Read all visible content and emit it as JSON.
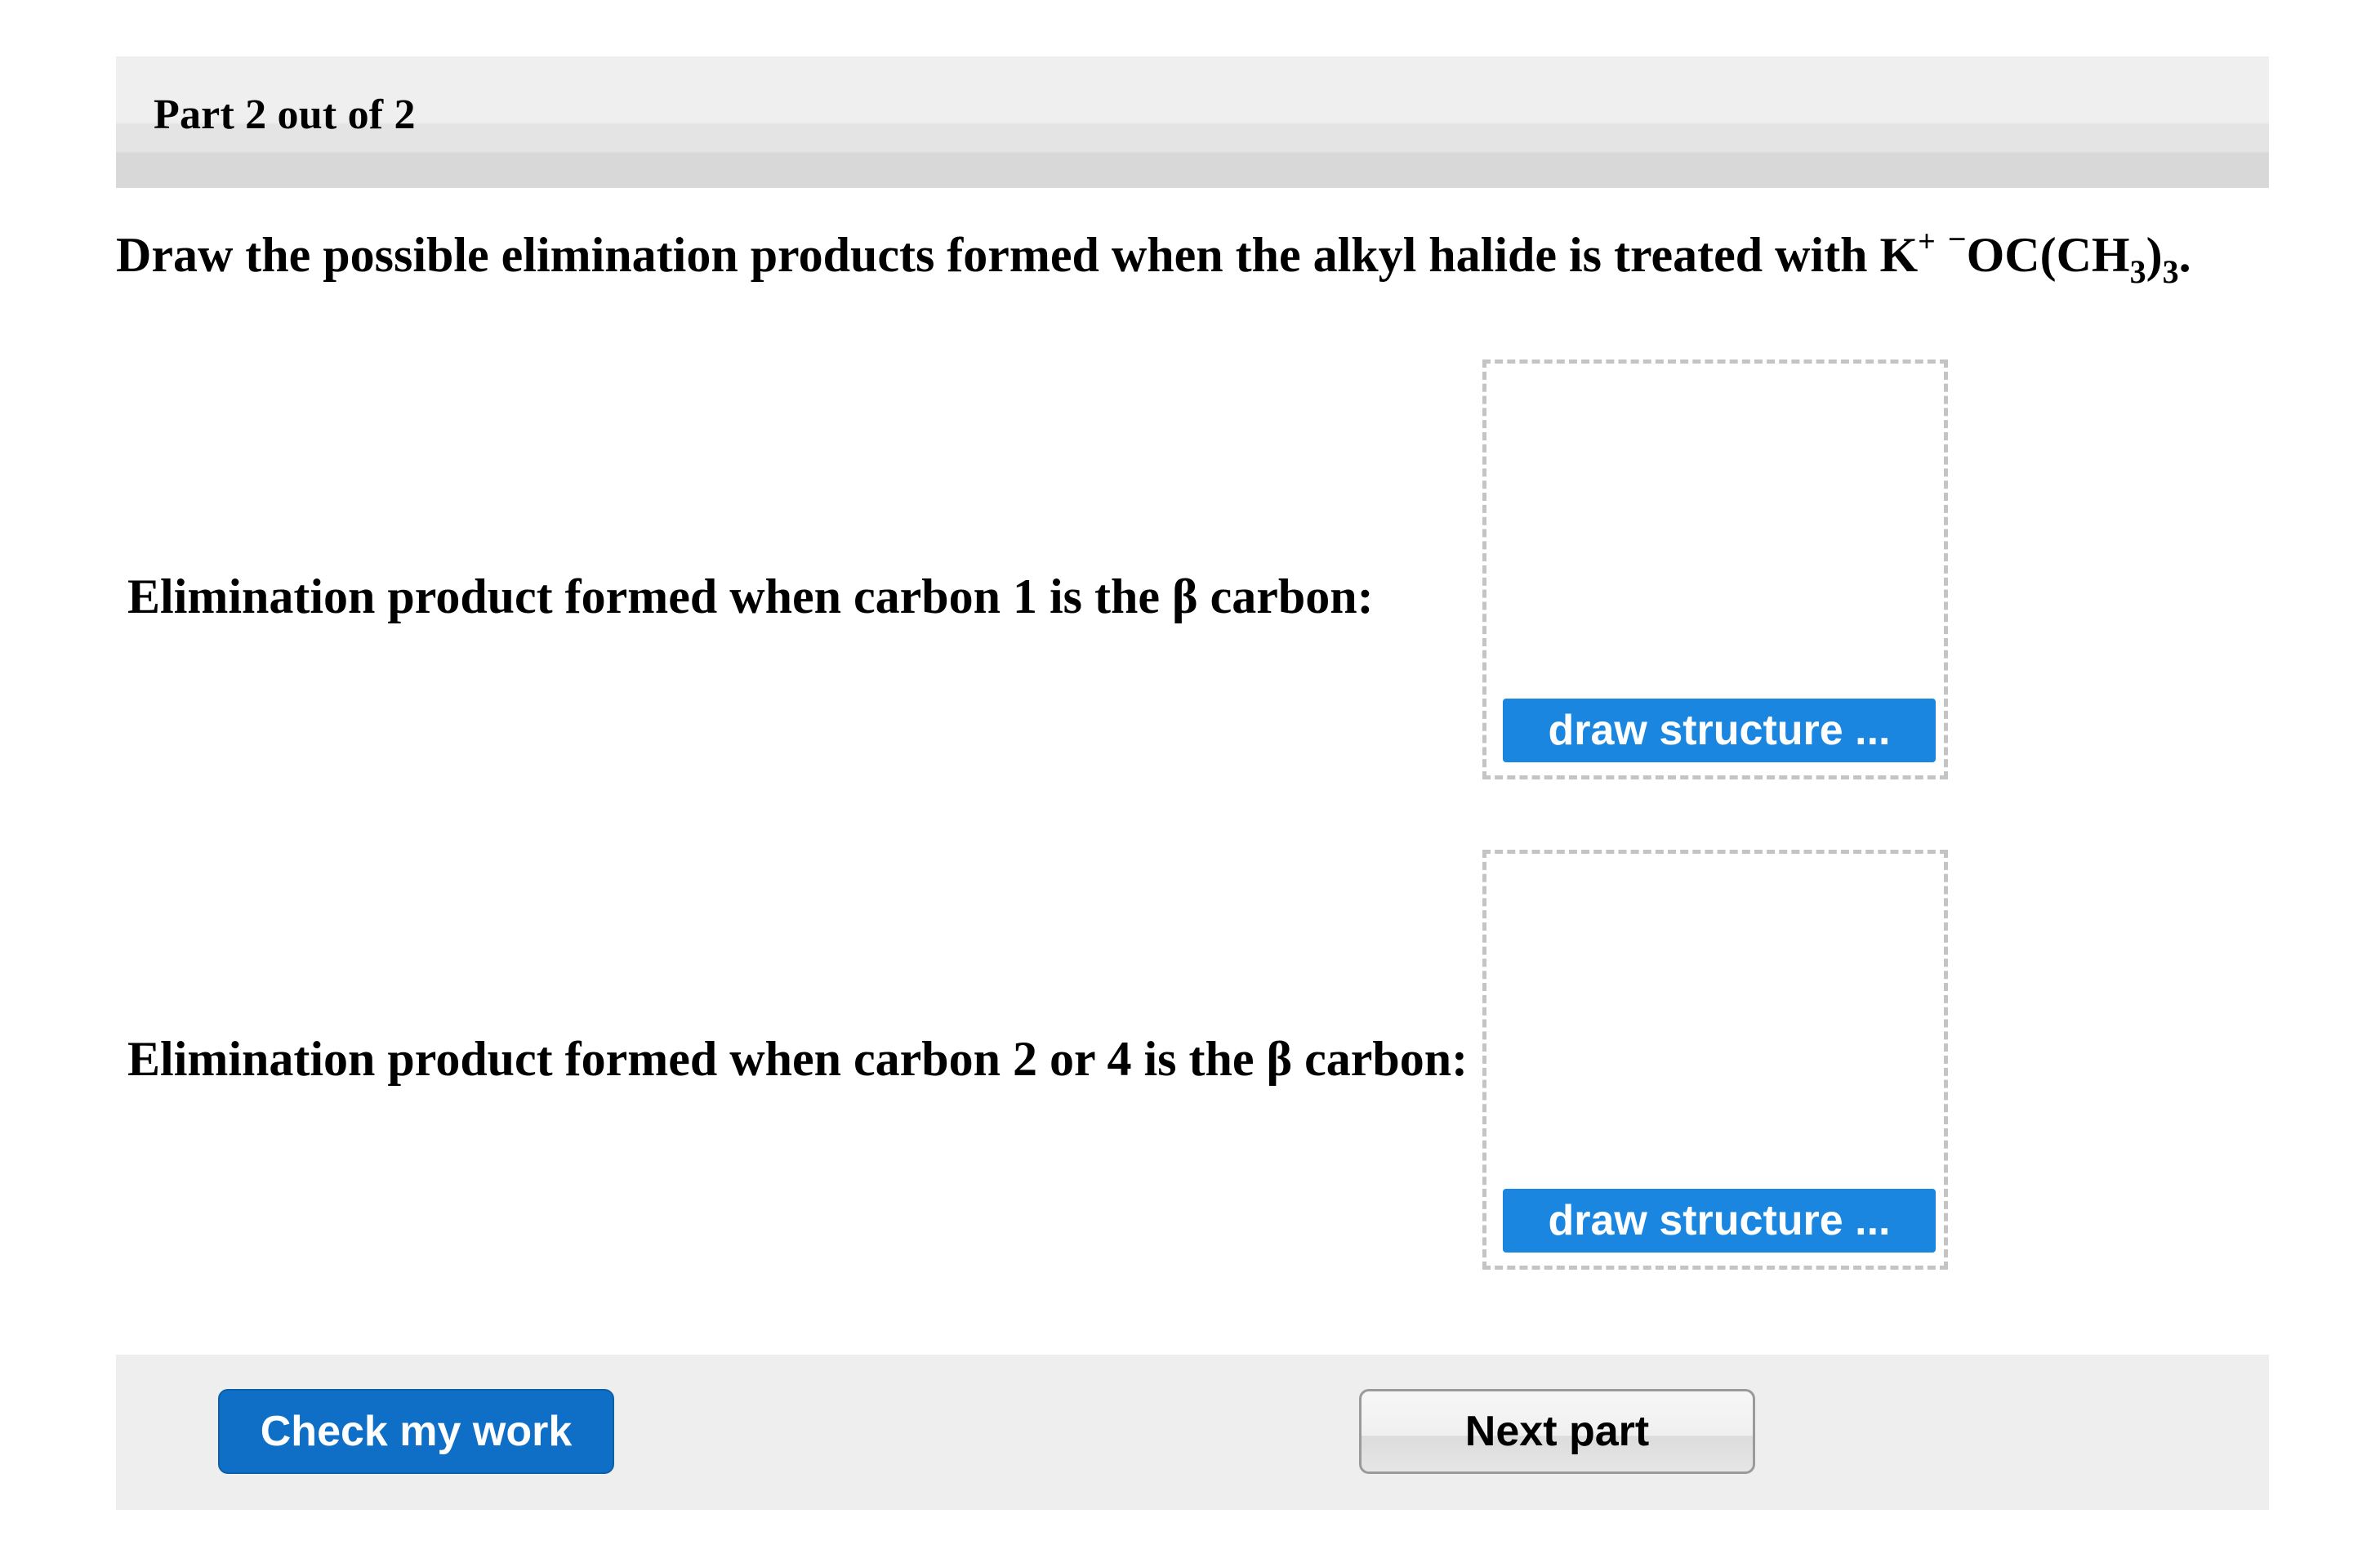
{
  "header": {
    "part_label": "Part 2 out of 2"
  },
  "question": {
    "lead": "Draw the possible elimination products formed when the alkyl halide is treated with K",
    "k_charge": "+",
    "anion_charge": "−",
    "anion_a": "OC(CH",
    "subscript_inner": "3",
    "anion_b": ")",
    "subscript_outer": "3",
    "period": "."
  },
  "rows": [
    {
      "label": "Elimination product formed when carbon 1 is the β carbon:",
      "button_label": "draw structure ..."
    },
    {
      "label": "Elimination product formed when carbon 2 or 4 is the β carbon:",
      "button_label": "draw structure ..."
    }
  ],
  "footer": {
    "check_label": "Check my work",
    "next_label": "Next part"
  },
  "colors": {
    "primary_blue": "#1a86e0",
    "check_blue": "#0f6fc6",
    "header_gray": "#e4e4e4",
    "footer_gray": "#eeeeee"
  }
}
